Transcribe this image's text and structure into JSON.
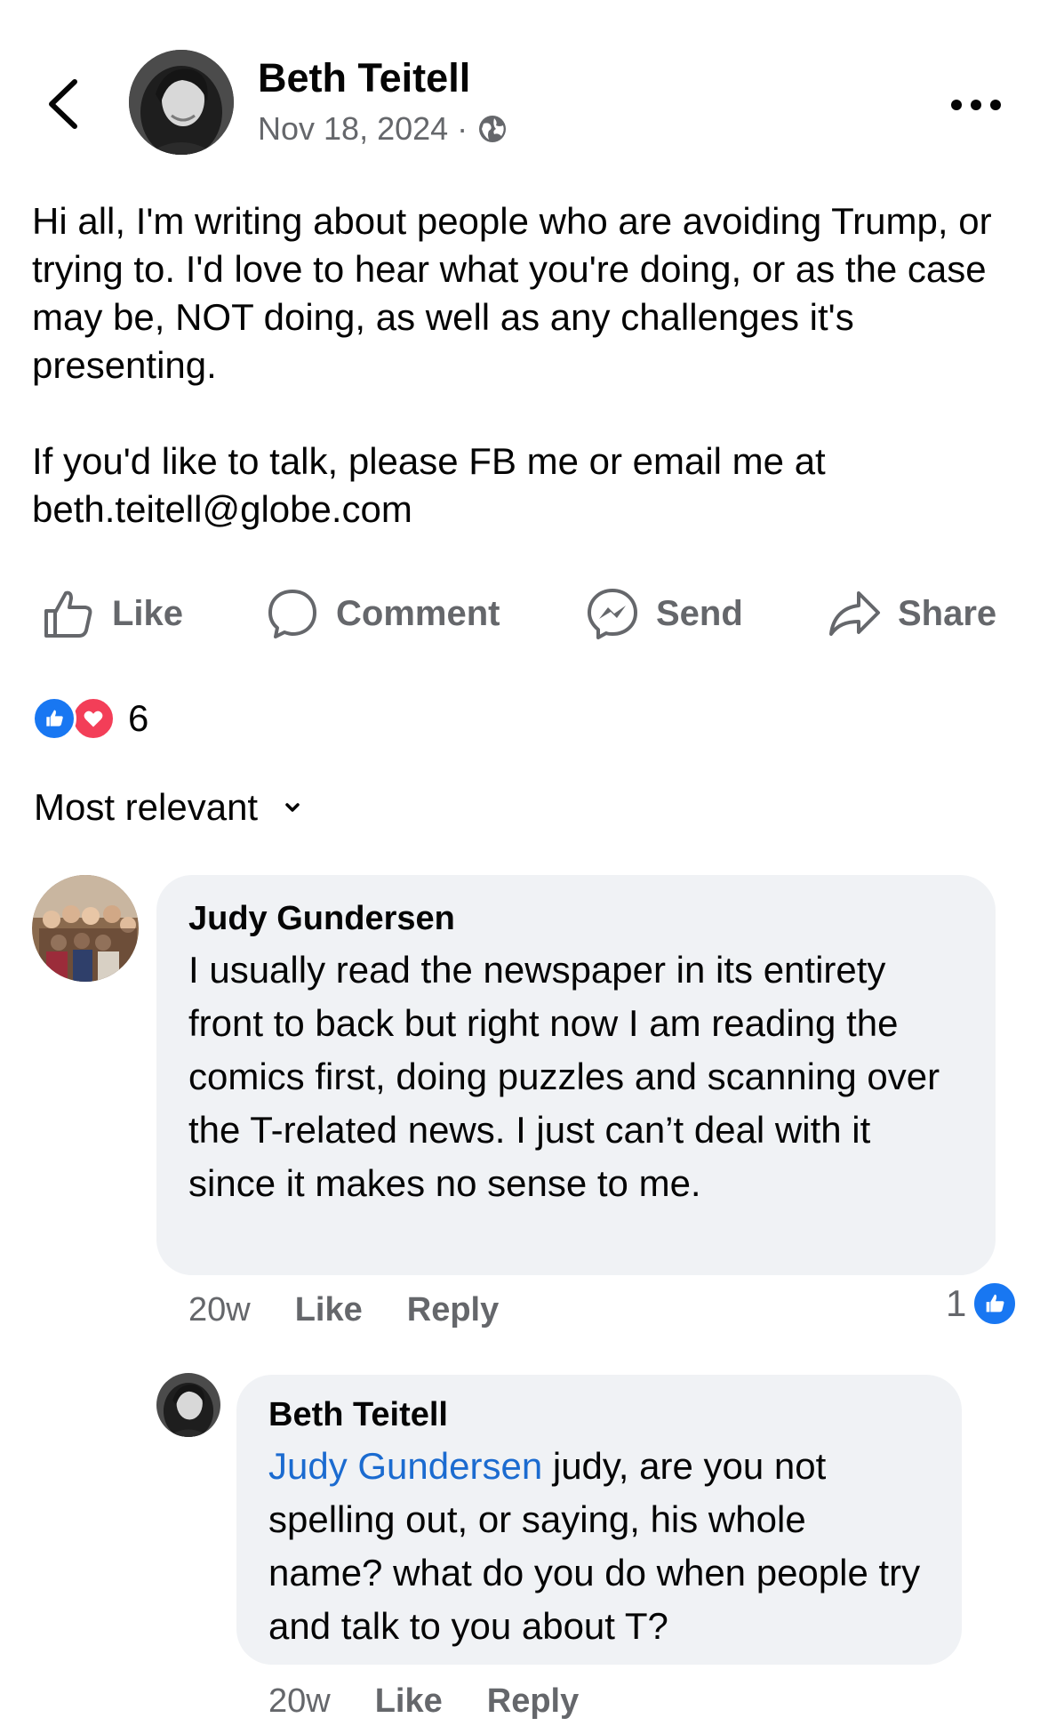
{
  "post": {
    "author": "Beth Teitell",
    "date": "Nov 18, 2024",
    "separator": "·",
    "audience_icon": "globe-icon",
    "paragraph_1": "Hi all, I'm writing about people who are avoiding Trump, or trying to. I'd love to hear what you're doing, or as the case may be, NOT doing, as well as any challenges it's presenting.",
    "paragraph_2": "If you'd like to talk, please FB me or email me at beth.teitell@globe.com"
  },
  "actions": {
    "like": "Like",
    "comment": "Comment",
    "send": "Send",
    "share": "Share"
  },
  "reactions": {
    "count": "6",
    "types": [
      "like",
      "love"
    ]
  },
  "sort": {
    "label": "Most relevant"
  },
  "comments": [
    {
      "author": "Judy Gundersen",
      "text": "I usually read the newspaper in its entirety front to back but right now I am reading the comics first, doing puzzles and scanning over the T-related news. I just can’t deal with it since it makes no sense to me.",
      "time": "20w",
      "like_label": "Like",
      "reply_label": "Reply",
      "reaction_count": "1"
    },
    {
      "author": "Beth Teitell",
      "mention": "Judy Gundersen",
      "text": " judy, are you not spelling out, or saying, his whole name? what do you do when people try and talk to you about T?",
      "time": "20w",
      "like_label": "Like",
      "reply_label": "Reply"
    }
  ],
  "colors": {
    "text": "#050505",
    "secondary": "#65676b",
    "bubble": "#f0f2f5",
    "like_blue": "#1877f2",
    "love_red": "#f33e58",
    "mention_blue": "#1b6bd0"
  }
}
